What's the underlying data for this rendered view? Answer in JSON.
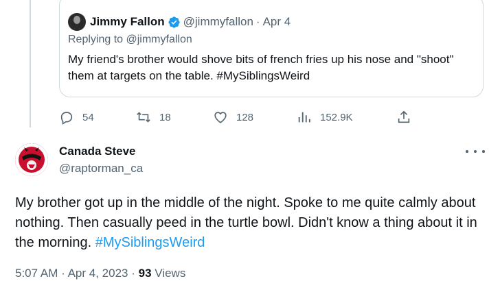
{
  "quoted": {
    "name": "Jimmy Fallon",
    "handle": "@jimmyfallon",
    "separator": "·",
    "date": "Apr 4",
    "replying_to": "Replying to @jimmyfallon",
    "text": "My friend's brother would shove bits of french fries up his nose and \"shoot\" them at targets on the table. #MySiblingsWeird"
  },
  "actions": {
    "replies": "54",
    "retweets": "18",
    "likes": "128",
    "views": "152.9K"
  },
  "tweet": {
    "name": "Canada Steve",
    "handle": "@raptorman_ca",
    "text": "My brother got up in the middle of the night. Spoke to me quite calmly about nothing. Then casually peed in the turtle bowl. Didn't know a thing about it in the morning. ",
    "hashtag": "#MySiblingsWeird",
    "time": "5:07 AM",
    "date": "Apr 4, 2023",
    "dot": "·",
    "views_count": "93",
    "views_label": "Views"
  },
  "colors": {
    "accent": "#1d9bf0",
    "muted": "#536471",
    "text": "#0f1419",
    "border": "#cfd9de"
  },
  "icons": [
    "verified-badge-icon",
    "reply-icon",
    "retweet-icon",
    "like-icon",
    "views-icon",
    "share-icon",
    "more-icon"
  ]
}
